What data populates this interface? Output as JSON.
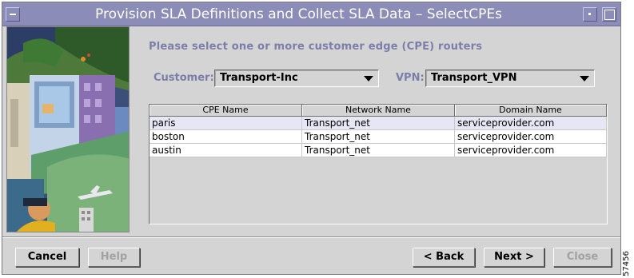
{
  "window": {
    "title": "Provision SLA Definitions and Collect SLA Data – SelectCPEs"
  },
  "prompt": "Please select one or more customer edge (CPE) routers",
  "customer": {
    "label": "Customer:",
    "value": "Transport-Inc"
  },
  "vpn": {
    "label": "VPN:",
    "value": "Transport_VPN"
  },
  "table": {
    "columns": [
      "CPE Name",
      "Network Name",
      "Domain Name"
    ],
    "rows": [
      [
        "paris",
        "Transport_net",
        "serviceprovider.com"
      ],
      [
        "boston",
        "Transport_net",
        "serviceprovider.com"
      ],
      [
        "austin",
        "Transport_net",
        "serviceprovider.com"
      ]
    ],
    "selected_row": 0
  },
  "buttons": {
    "cancel": "Cancel",
    "help": "Help",
    "back": "< Back",
    "next": "Next >",
    "close": "Close"
  },
  "figure_number": "57456",
  "colors": {
    "titlebar": "#8c8cb8",
    "window_bg": "#d4d4d4",
    "label_text": "#7d7daa",
    "selected_row": "#e6e6f5"
  },
  "icons": {
    "window_menu": "window-menu-icon",
    "minimize": "minimize-icon",
    "maximize": "maximize-icon",
    "dropdown": "dropdown-arrow-icon"
  }
}
